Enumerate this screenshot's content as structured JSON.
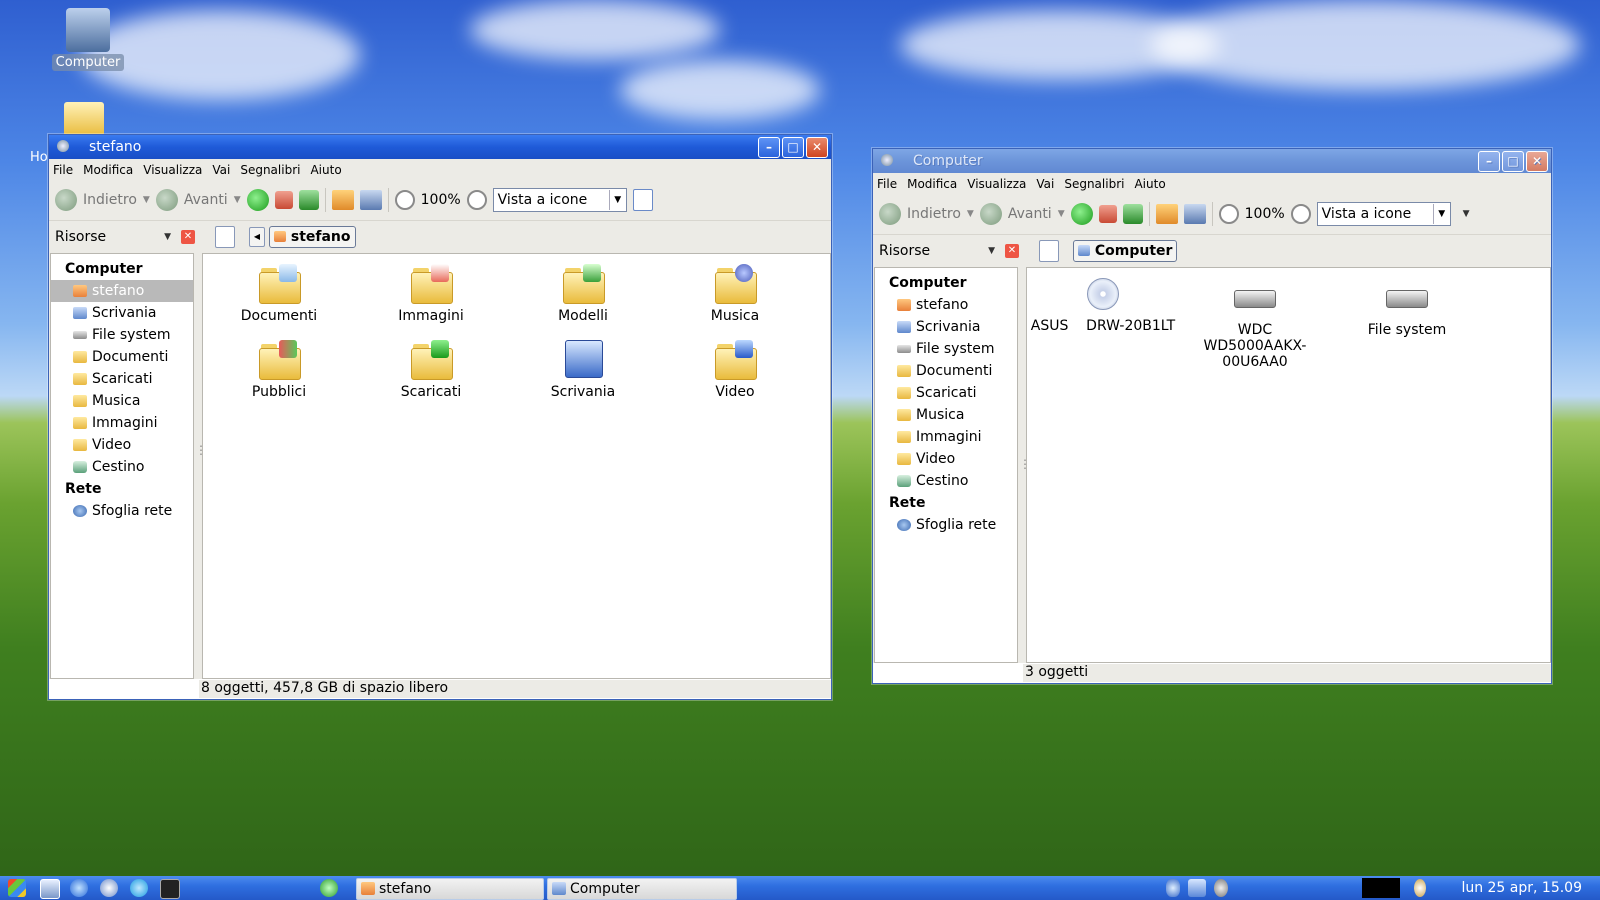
{
  "desktop": {
    "icons": [
      {
        "label": "Computer",
        "icon": "computer-icon"
      },
      {
        "label": "Ho",
        "icon": "home-folder-icon"
      }
    ]
  },
  "windows": {
    "stefano": {
      "title": "stefano",
      "menu": [
        "File",
        "Modifica",
        "Visualizza",
        "Vai",
        "Segnalibri",
        "Aiuto"
      ],
      "toolbar": {
        "back": "Indietro",
        "forward": "Avanti",
        "zoom": "100%",
        "view_mode": "Vista a icone"
      },
      "sidebar": {
        "dropdown": "Risorse",
        "sections": [
          {
            "heading": "Computer",
            "items": [
              "stefano",
              "Scrivania",
              "File system",
              "Documenti",
              "Scaricati",
              "Musica",
              "Immagini",
              "Video",
              "Cestino"
            ]
          },
          {
            "heading": "Rete",
            "items": [
              "Sfoglia rete"
            ]
          }
        ],
        "selected": "stefano"
      },
      "location": "stefano",
      "items": [
        "Documenti",
        "Immagini",
        "Modelli",
        "Musica",
        "Pubblici",
        "Scaricati",
        "Scrivania",
        "Video"
      ],
      "status": "8 oggetti, 457,8 GB di spazio libero"
    },
    "computer": {
      "title": "Computer",
      "menu": [
        "File",
        "Modifica",
        "Visualizza",
        "Vai",
        "Segnalibri",
        "Aiuto"
      ],
      "toolbar": {
        "back": "Indietro",
        "forward": "Avanti",
        "zoom": "100%",
        "view_mode": "Vista a icone"
      },
      "sidebar": {
        "dropdown": "Risorse",
        "sections": [
          {
            "heading": "Computer",
            "items": [
              "stefano",
              "Scrivania",
              "File system",
              "Documenti",
              "Scaricati",
              "Musica",
              "Immagini",
              "Video",
              "Cestino"
            ]
          },
          {
            "heading": "Rete",
            "items": [
              "Sfoglia rete"
            ]
          }
        ]
      },
      "location": "Computer",
      "items": [
        "ASUS    DRW-20B1LT",
        "WDC WD5000AAKX-00U6AA0",
        "File system"
      ],
      "status": "3 oggetti"
    }
  },
  "taskbar": {
    "tasks": [
      "stefano",
      "Computer"
    ],
    "clock": "lun 25 apr, 15.09"
  },
  "colors": {
    "title_active": "#1f5ad8",
    "title_inactive": "#6c95da",
    "taskbar": "#2f6fe0"
  }
}
